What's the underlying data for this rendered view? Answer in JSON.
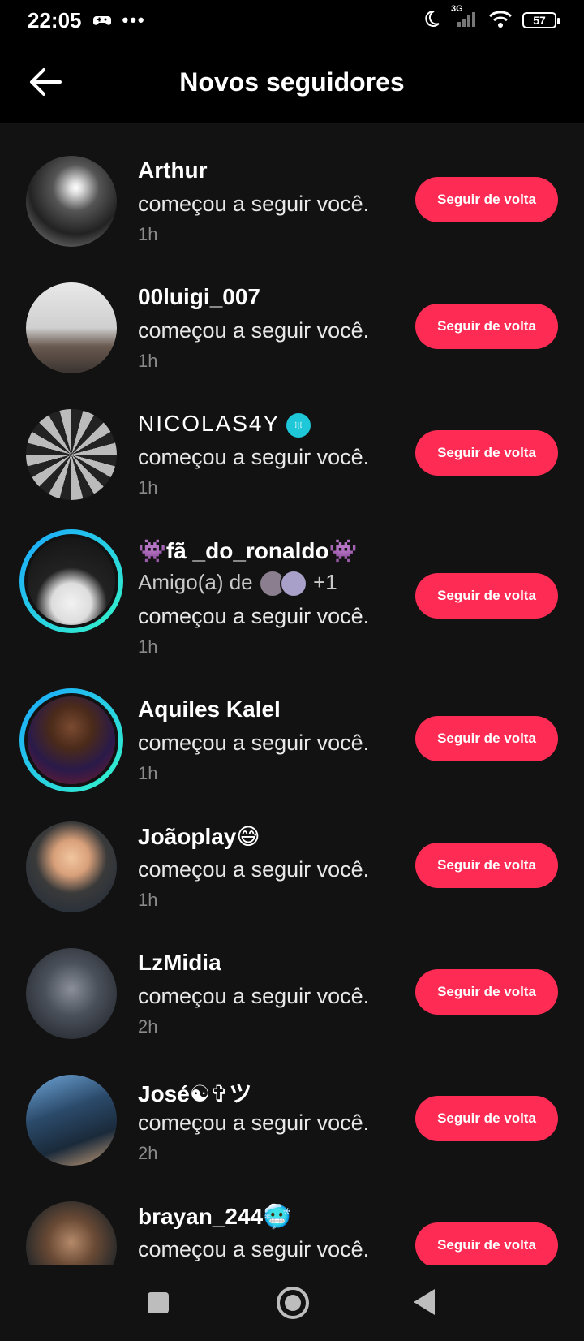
{
  "status": {
    "time": "22:05",
    "network": "3G",
    "battery": "57"
  },
  "header": {
    "title": "Novos seguidores"
  },
  "followers": [
    {
      "name": "Arthur",
      "action": "começou a seguir você.",
      "time": "1h",
      "button": "Seguir de volta"
    },
    {
      "name": "00luigi_007",
      "action": "começou a seguir você.",
      "time": "1h",
      "button": "Seguir de volta"
    },
    {
      "name": "NICOLAS4Y",
      "action": "começou a seguir você.",
      "time": "1h",
      "button": "Seguir de volta"
    },
    {
      "name": "fã _do_ronaldo",
      "friend_of": "Amigo(a) de",
      "friend_extra": "+1",
      "action": "começou a seguir você.",
      "time": "1h",
      "button": "Seguir de volta"
    },
    {
      "name": "Aquiles Kalel",
      "action": "começou a seguir você.",
      "time": "1h",
      "button": "Seguir de volta"
    },
    {
      "name": "Joãoplay",
      "action": "começou a seguir você.",
      "time": "1h",
      "button": "Seguir de volta"
    },
    {
      "name": "LzMidia",
      "action": "começou a seguir você.",
      "time": "2h",
      "button": "Seguir de volta"
    },
    {
      "name": "José☯✞ツ",
      "action": "começou a seguir você.",
      "time": "2h",
      "button": "Seguir de volta"
    },
    {
      "name": "brayan_244",
      "action": "começou a seguir você.",
      "button": "Seguir de volta"
    }
  ],
  "colors": {
    "accent": "#fe2c55",
    "background": "#121212",
    "ring_start": "#1aa7ff",
    "ring_end": "#35f5c8"
  }
}
